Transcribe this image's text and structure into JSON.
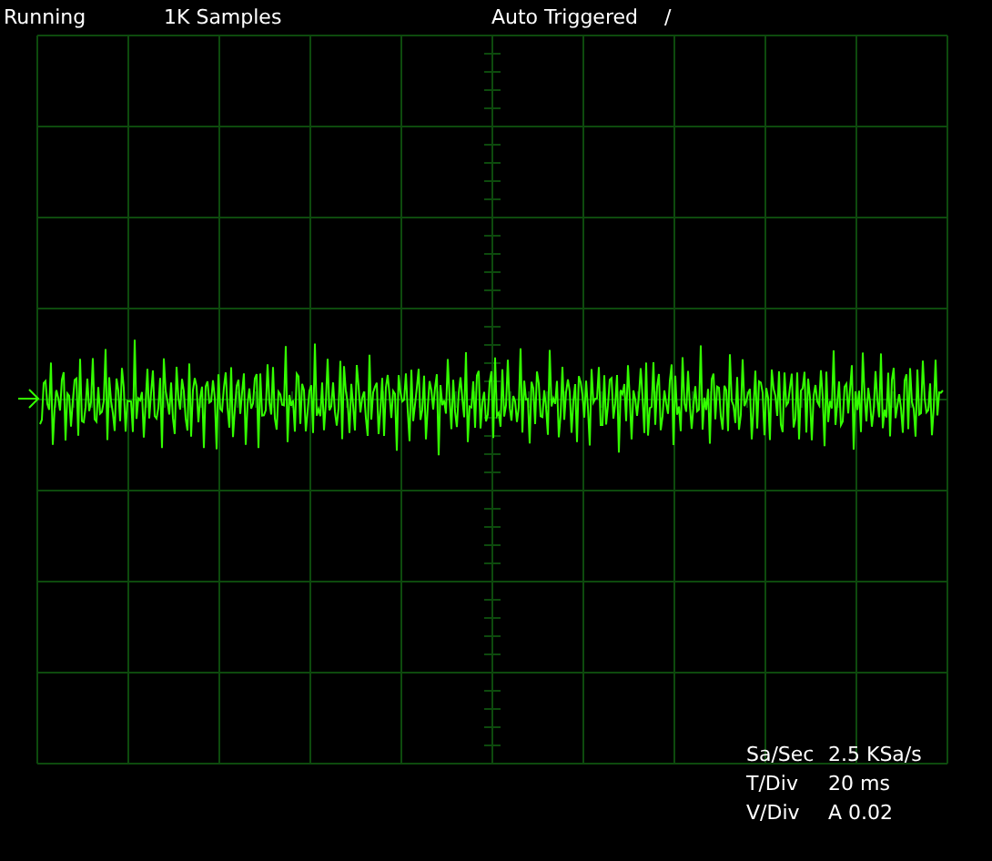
{
  "status_bar": {
    "run_state": "Running",
    "samples": "1K Samples",
    "trigger_mode": "Auto Triggered",
    "trigger_slope": "/"
  },
  "readouts": [
    {
      "label": "Sa/Sec",
      "value": "2.5 KSa/s"
    },
    {
      "label": "T/Div",
      "value": "20 ms"
    },
    {
      "label": "V/Div",
      "value": "A 0.02"
    }
  ]
}
